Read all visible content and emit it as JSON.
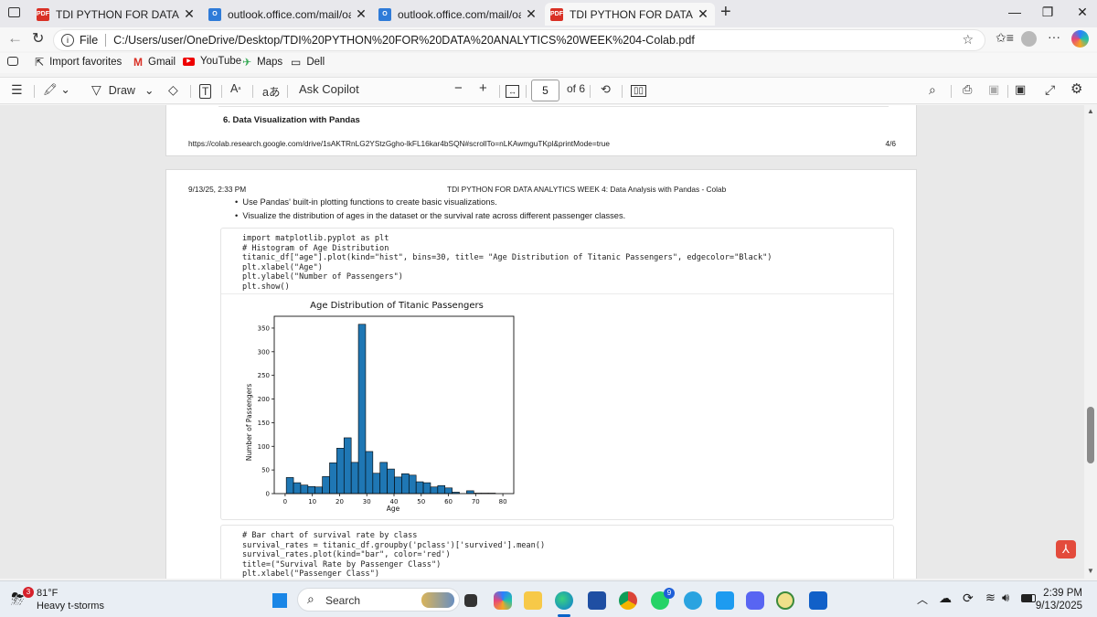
{
  "browser": {
    "tabs": [
      {
        "title": "TDI PYTHON FOR DATA ANALYTIC",
        "icon": "pdf-file-icon",
        "active": false
      },
      {
        "title": "outlook.office.com/mail/oauthRec",
        "icon": "outlook-icon",
        "active": false
      },
      {
        "title": "outlook.office.com/mail/oauthRec",
        "icon": "outlook-icon",
        "active": false
      },
      {
        "title": "TDI PYTHON FOR DATA ANALYTIC",
        "icon": "pdf-file-icon",
        "active": true
      }
    ],
    "address_prefix": "File",
    "address": "C:/Users/user/OneDrive/Desktop/TDI%20PYTHON%20FOR%20DATA%20ANALYTICS%20WEEK%204-Colab.pdf",
    "bookmarks": [
      "Import favorites",
      "Gmail",
      "YouTube",
      "Maps",
      "Dell"
    ]
  },
  "pdf_toolbar": {
    "draw_label": "Draw",
    "copilot_label": "Ask Copilot",
    "page_number": "5",
    "page_total": "of 6"
  },
  "page_prev": {
    "section_title": "6. Data Visualization with Pandas",
    "footer_url": "https://colab.research.google.com/drive/1sAKTRnLG2YStzGgho-lkFL16kar4bSQN#scrollTo=nLKAwmguTKpl&printMode=true",
    "footer_page": "4/6"
  },
  "page_current": {
    "header_date": "9/13/25, 2:33 PM",
    "header_title": "TDI PYTHON FOR DATA ANALYTICS WEEK 4: Data Analysis with Pandas - Colab",
    "bullets": [
      "Use Pandas' built-in plotting functions to create basic visualizations.",
      "Visualize the distribution of ages in the dataset or the survival rate across different passenger classes."
    ],
    "code1": [
      "import matplotlib.pyplot as plt",
      "# Histogram of Age Distribution",
      "titanic_df[\"age\"].plot(kind=\"hist\", bins=30, title= \"Age Distribution of Titanic Passengers\", edgecolor=\"Black\")",
      "plt.xlabel(\"Age\")",
      "plt.ylabel(\"Number of Passengers\")",
      "plt.show()"
    ],
    "code2": [
      "# Bar chart of survival rate by class",
      "survival_rates = titanic_df.groupby('pclass')['survived'].mean()",
      "survival_rates.plot(kind=\"bar\", color='red')",
      "title=(\"Survival Rate by Passenger Class\")",
      "plt.xlabel(\"Passenger Class\")"
    ]
  },
  "chart_data": {
    "type": "bar",
    "title": "Age Distribution of Titanic Passengers",
    "xlabel": "Age",
    "ylabel": "Number of Passengers",
    "bar_color": "#1f77b4",
    "xlim": [
      -4,
      84
    ],
    "ylim": [
      0,
      375
    ],
    "xticks": [
      0,
      10,
      20,
      30,
      40,
      50,
      60,
      70,
      80
    ],
    "yticks": [
      0,
      50,
      100,
      150,
      200,
      250,
      300,
      350
    ],
    "bin_width": 2.65,
    "bin_start": 0.42,
    "values": [
      34,
      23,
      18,
      15,
      14,
      36,
      65,
      96,
      118,
      66,
      358,
      89,
      43,
      66,
      52,
      35,
      42,
      39,
      25,
      23,
      14,
      17,
      12,
      3,
      0,
      6,
      1,
      1,
      1,
      0
    ]
  },
  "taskbar": {
    "weather_temp": "81°F",
    "weather_desc": "Heavy t-storms",
    "weather_badge": "3",
    "search_label": "Search",
    "time": "2:39 PM",
    "date": "9/13/2025",
    "telegram_badge": "9"
  }
}
